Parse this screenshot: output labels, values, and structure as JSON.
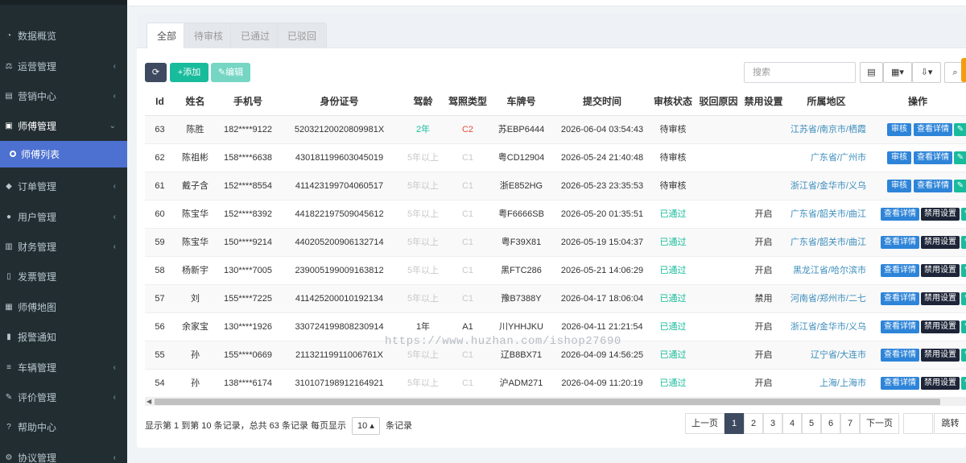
{
  "sidebar": {
    "items": [
      {
        "label": "数据概览",
        "icon": "dashboard-icon",
        "chevron": false
      },
      {
        "label": "运营管理",
        "icon": "scale-icon",
        "chevron": true
      },
      {
        "label": "营销中心",
        "icon": "document-icon",
        "chevron": true
      },
      {
        "label": "师傅管理",
        "icon": "id-card-icon",
        "chevron": true,
        "expanded": true
      },
      {
        "label": "师傅列表",
        "icon": "circle-icon",
        "sub": true,
        "active": true
      },
      {
        "label": "订单管理",
        "icon": "cube-icon",
        "chevron": true
      },
      {
        "label": "用户管理",
        "icon": "user-icon",
        "chevron": true
      },
      {
        "label": "财务管理",
        "icon": "money-icon",
        "chevron": true
      },
      {
        "label": "发票管理",
        "icon": "file-icon",
        "chevron": false
      },
      {
        "label": "师傅地图",
        "icon": "map-icon",
        "chevron": false
      },
      {
        "label": "报警通知",
        "icon": "bar-chart-icon",
        "chevron": false
      },
      {
        "label": "车辆管理",
        "icon": "list-icon",
        "chevron": true
      },
      {
        "label": "评价管理",
        "icon": "edit-icon",
        "chevron": true
      },
      {
        "label": "帮助中心",
        "icon": "question-icon",
        "chevron": false
      },
      {
        "label": "协议管理",
        "icon": "gear-icon",
        "chevron": true
      }
    ]
  },
  "tabs": [
    "全部",
    "待审核",
    "已通过",
    "已驳回"
  ],
  "toolbar": {
    "refresh_icon": "refresh-icon",
    "add_label": "添加",
    "edit_label": "编辑",
    "search_placeholder": "搜索"
  },
  "table": {
    "headers": [
      "Id",
      "姓名",
      "手机号",
      "身份证号",
      "驾龄",
      "驾照类型",
      "车牌号",
      "提交时间",
      "审核状态",
      "驳回原因",
      "禁用设置",
      "所属地区",
      "操作"
    ],
    "rows": [
      {
        "id": "63",
        "name": "陈胜",
        "phone": "182****9122",
        "idcard": "52032120020809981X",
        "age": "2年",
        "license": "C2",
        "plate": "苏EBP6444",
        "time": "2026-06-04 03:54:43",
        "status": "待审核",
        "reject": "",
        "ban": "",
        "region": "江苏省/南京市/栖霞",
        "ops": [
          "审核",
          "查看详情"
        ]
      },
      {
        "id": "62",
        "name": "陈祖彬",
        "phone": "158****6638",
        "idcard": "430181199603045019",
        "age": "5年以上",
        "license": "C1",
        "plate": "粤CD12904",
        "time": "2026-05-24 21:40:48",
        "status": "待审核",
        "reject": "",
        "ban": "",
        "region": "广东省/广州市",
        "ops": [
          "审核",
          "查看详情"
        ]
      },
      {
        "id": "61",
        "name": "戴子含",
        "phone": "152****8554",
        "idcard": "411423199704060517",
        "age": "5年以上",
        "license": "C1",
        "plate": "浙E852HG",
        "time": "2026-05-23 23:35:53",
        "status": "待审核",
        "reject": "",
        "ban": "",
        "region": "浙江省/金华市/义乌",
        "ops": [
          "审核",
          "查看详情"
        ]
      },
      {
        "id": "60",
        "name": "陈宝华",
        "phone": "152****8392",
        "idcard": "441822197509045612",
        "age": "5年以上",
        "license": "C1",
        "plate": "粤F6666SB",
        "time": "2026-05-20 01:35:51",
        "status": "已通过",
        "reject": "",
        "ban": "开启",
        "region": "广东省/韶关市/曲江",
        "ops": [
          "查看详情",
          "禁用设置"
        ]
      },
      {
        "id": "59",
        "name": "陈宝华",
        "phone": "150****9214",
        "idcard": "440205200906132714",
        "age": "5年以上",
        "license": "C1",
        "plate": "粤F39X81",
        "time": "2026-05-19 15:04:37",
        "status": "已通过",
        "reject": "",
        "ban": "开启",
        "region": "广东省/韶关市/曲江",
        "ops": [
          "查看详情",
          "禁用设置"
        ]
      },
      {
        "id": "58",
        "name": "杨新宇",
        "phone": "130****7005",
        "idcard": "239005199009163812",
        "age": "5年以上",
        "license": "C1",
        "plate": "黑FTC286",
        "time": "2026-05-21 14:06:29",
        "status": "已通过",
        "reject": "",
        "ban": "开启",
        "region": "黑龙江省/哈尔滨市",
        "ops": [
          "查看详情",
          "禁用设置"
        ]
      },
      {
        "id": "57",
        "name": "刘",
        "phone": "155****7225",
        "idcard": "411425200010192134",
        "age": "5年以上",
        "license": "C1",
        "plate": "豫B7388Y",
        "time": "2026-04-17 18:06:04",
        "status": "已通过",
        "reject": "",
        "ban": "禁用",
        "region": "河南省/郑州市/二七",
        "ops": [
          "查看详情",
          "禁用设置"
        ]
      },
      {
        "id": "56",
        "name": "余家宝",
        "phone": "130****1926",
        "idcard": "330724199808230914",
        "age": "1年",
        "license": "A1",
        "plate": "川YHHJKU",
        "time": "2026-04-11 21:21:54",
        "status": "已通过",
        "reject": "",
        "ban": "开启",
        "region": "浙江省/金华市/义乌",
        "ops": [
          "查看详情",
          "禁用设置"
        ]
      },
      {
        "id": "55",
        "name": "孙",
        "phone": "155****0669",
        "idcard": "21132119911006761X",
        "age": "5年以上",
        "license": "C1",
        "plate": "辽B8BX71",
        "time": "2026-04-09 14:56:25",
        "status": "已通过",
        "reject": "",
        "ban": "开启",
        "region": "辽宁省/大连市",
        "ops": [
          "查看详情",
          "禁用设置"
        ]
      },
      {
        "id": "54",
        "name": "孙",
        "phone": "138****6174",
        "idcard": "310107198912164921",
        "age": "5年以上",
        "license": "C1",
        "plate": "沪ADM271",
        "time": "2026-04-09 11:20:19",
        "status": "已通过",
        "reject": "",
        "ban": "开启",
        "region": "上海/上海市",
        "ops": [
          "查看详情",
          "禁用设置"
        ]
      }
    ]
  },
  "footer": {
    "summary_prefix": "显示第 1 到第 10 条记录，总共 63 条记录 每页显示",
    "page_size": "10",
    "summary_suffix": "条记录",
    "pages": [
      "上一页",
      "1",
      "2",
      "3",
      "4",
      "5",
      "6",
      "7",
      "下一页"
    ],
    "current_page": "1",
    "jump_label": "跳转"
  },
  "watermark": "https://www.huzhan.com/ishop27690",
  "colors": {
    "sidebar_bg": "#222d32",
    "sidebar_active": "#4d71d1",
    "primary_green": "#18bc9c",
    "primary_blue": "#2d84d8",
    "dark_button": "#1e2538",
    "pager_active": "#3d4a60"
  }
}
